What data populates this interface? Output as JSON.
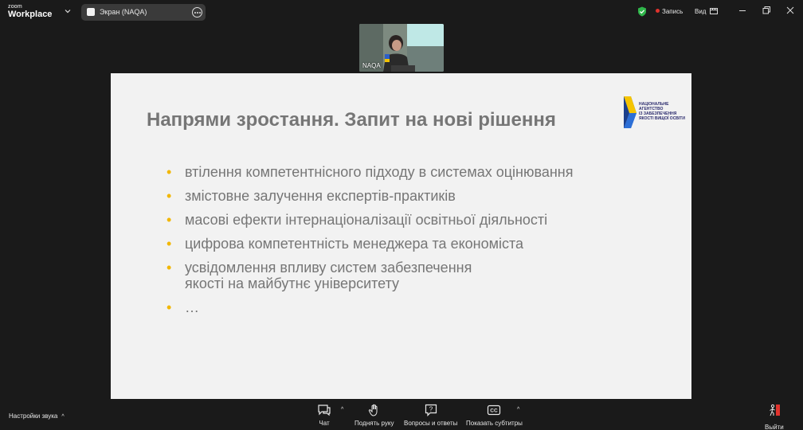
{
  "titlebar": {
    "logo_top": "zoom",
    "logo_bottom": "Workplace",
    "share_tab_label": "Экран (NAQA)",
    "record_label": "Запись",
    "view_label": "Вид"
  },
  "video": {
    "participant_name": "NAQA"
  },
  "slide": {
    "title": "Напрями зростання. Запит на нові рішення",
    "logo_text": "НАЦІОНАЛЬНЕ\nАГЕНТСТВО\nІЗ ЗАБЕЗПЕЧЕННЯ\nЯКОСТІ ВИЩОЇ ОСВІТИ",
    "bullet_char": "•",
    "bullets": [
      "втілення компетентнісного підходу в системах оцінювання",
      "змістовне залучення експертів-практиків",
      "масові ефекти інтернаціоналізації освітньої діяльності",
      "цифрова компетентність менеджера та економіста",
      "усвідомлення впливу систем забезпечення\nякості на майбутнє університету",
      "…"
    ]
  },
  "toolbar": {
    "sound_settings": "Настройки звука",
    "chat": "Чат",
    "raise_hand": "Поднять руку",
    "qa": "Вопросы и ответы",
    "captions": "Показать субтитры",
    "captions_icon_text": "CC",
    "leave": "Выйти"
  },
  "colors": {
    "bullet": "#f2b705",
    "slide_text": "#767676",
    "record_dot": "#e0332d",
    "shield": "#2fb54a"
  }
}
